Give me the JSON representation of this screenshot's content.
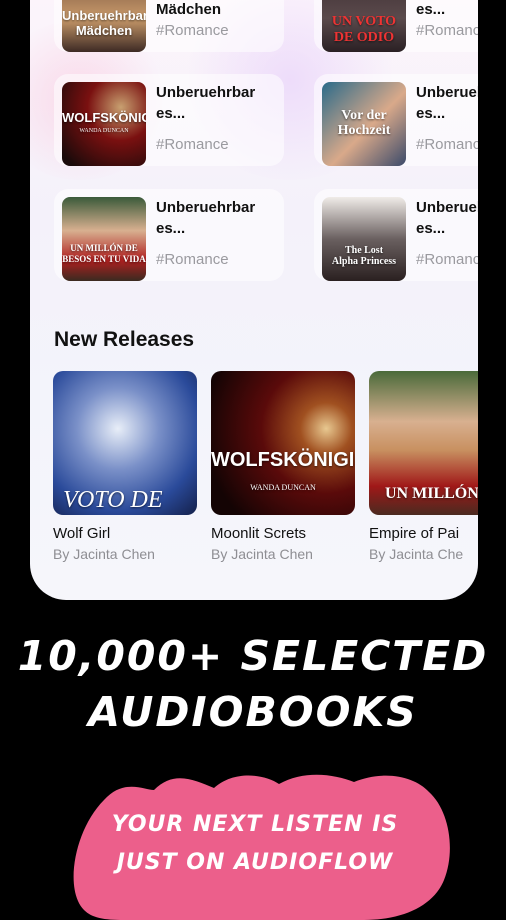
{
  "grid": [
    {
      "title": "Unberueuhbares\nMädchen",
      "tag": "#Romance",
      "cover_text": "Unberuehrbares\nMädchen"
    },
    {
      "title": "...\nes...",
      "tag": "#Romance",
      "cover_text": "UN VOTO\nDE ODIO"
    },
    {
      "title": "Unberuehrbar\nes...",
      "tag": "#Romance",
      "cover_text": "WOLFSKÖNIGIN",
      "cover_sub": "WANDA DUNCAN"
    },
    {
      "title": "Unberuehrbar\nes...",
      "tag": "#Romance",
      "cover_text": "Vor der\nHochzeit"
    },
    {
      "title": "Unberuehrbar\nes...",
      "tag": "#Romance",
      "cover_text": "UN MILLÓN DE\nBESOS EN TU VIDA"
    },
    {
      "title": "Unberuehrbar\nes...",
      "tag": "#Romance",
      "cover_text": "The Lost\nAlpha Princess"
    }
  ],
  "section": {
    "new_releases": "New Releases"
  },
  "releases": [
    {
      "title": "Wolf Girl",
      "author": "By Jacinta Chen",
      "cover_text": "VOTO DE"
    },
    {
      "title": "Moonlit Screts",
      "author": "By Jacinta Chen",
      "cover_text": "WOLFSKÖNIGIN",
      "cover_sub": "WANDA DUNCAN"
    },
    {
      "title": "Empire of Pai",
      "author": "By Jacinta Che",
      "cover_text": "UN MILLÓN"
    }
  ],
  "headline": "10,000+ SELECTED\nAUDIOBOOKS",
  "subline": "YOUR NEXT LISTEN IS\nJUST ON AUDIOFLOW",
  "colors": {
    "accent_pink": "#ec5f8b",
    "background": "#000000",
    "card_bg": "#f4f2fa"
  }
}
